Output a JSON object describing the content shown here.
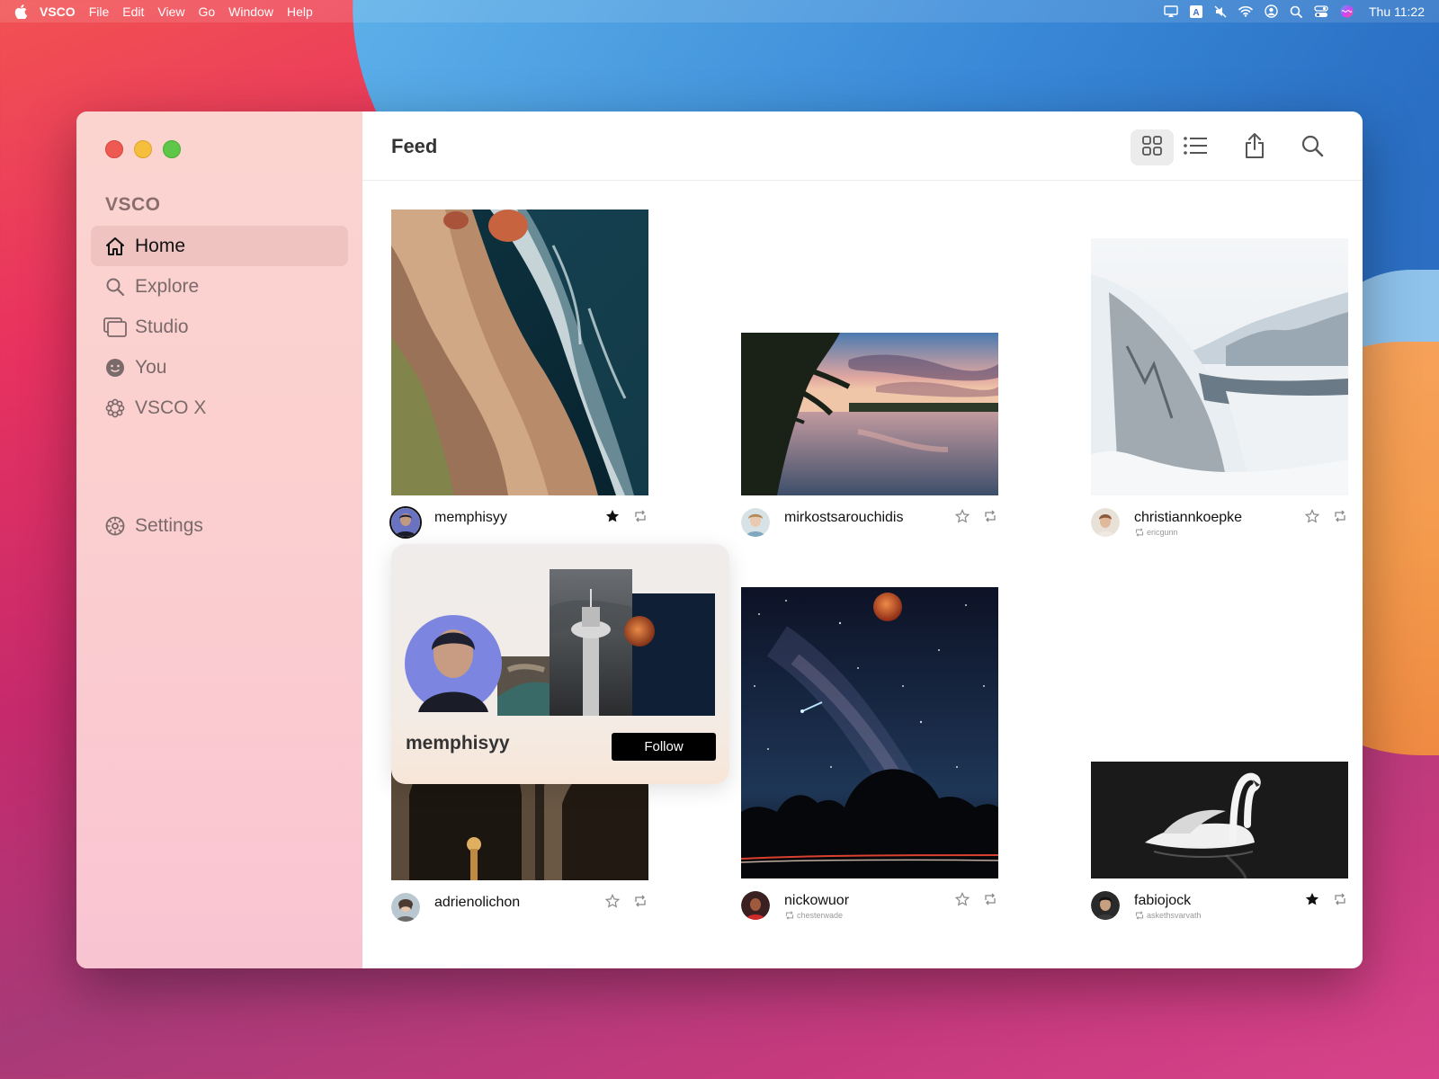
{
  "menubar": {
    "app": "VSCO",
    "items": [
      "File",
      "Edit",
      "View",
      "Go",
      "Window",
      "Help"
    ],
    "clock": "Thu 11:22"
  },
  "sidebar": {
    "brand": "VSCO",
    "items": [
      {
        "label": "Home",
        "icon": "house-icon",
        "active": true
      },
      {
        "label": "Explore",
        "icon": "search-icon",
        "active": false
      },
      {
        "label": "Studio",
        "icon": "studio-icon",
        "active": false
      },
      {
        "label": "You",
        "icon": "face-icon",
        "active": false
      },
      {
        "label": "VSCO X",
        "icon": "vsco-x-icon",
        "active": false
      }
    ],
    "settings": {
      "label": "Settings",
      "icon": "gear-icon"
    }
  },
  "toolbar": {
    "title": "Feed",
    "icons": [
      "grid-view-icon",
      "list-view-icon",
      "share-icon",
      "search-icon"
    ]
  },
  "feed": {
    "posts": [
      {
        "user": "memphisyy",
        "starred": true,
        "reposted_from": ""
      },
      {
        "user": "mirkostsarouchidis",
        "starred": false,
        "reposted_from": ""
      },
      {
        "user": "christiannkoepke",
        "starred": false,
        "reposted_from": "ericgunn"
      },
      {
        "user": "adrienolichon",
        "starred": false,
        "reposted_from": ""
      },
      {
        "user": "nickowuor",
        "starred": false,
        "reposted_from": "chesterwade"
      },
      {
        "user": "fabiojock",
        "starred": true,
        "reposted_from": "askethsvarvath"
      }
    ]
  },
  "popover": {
    "name": "memphisyy",
    "follow_label": "Follow"
  },
  "colors": {
    "sidebar_top": "#fbd4d0",
    "sidebar_bottom": "#f9c4d2",
    "follow_button": "#000000"
  }
}
